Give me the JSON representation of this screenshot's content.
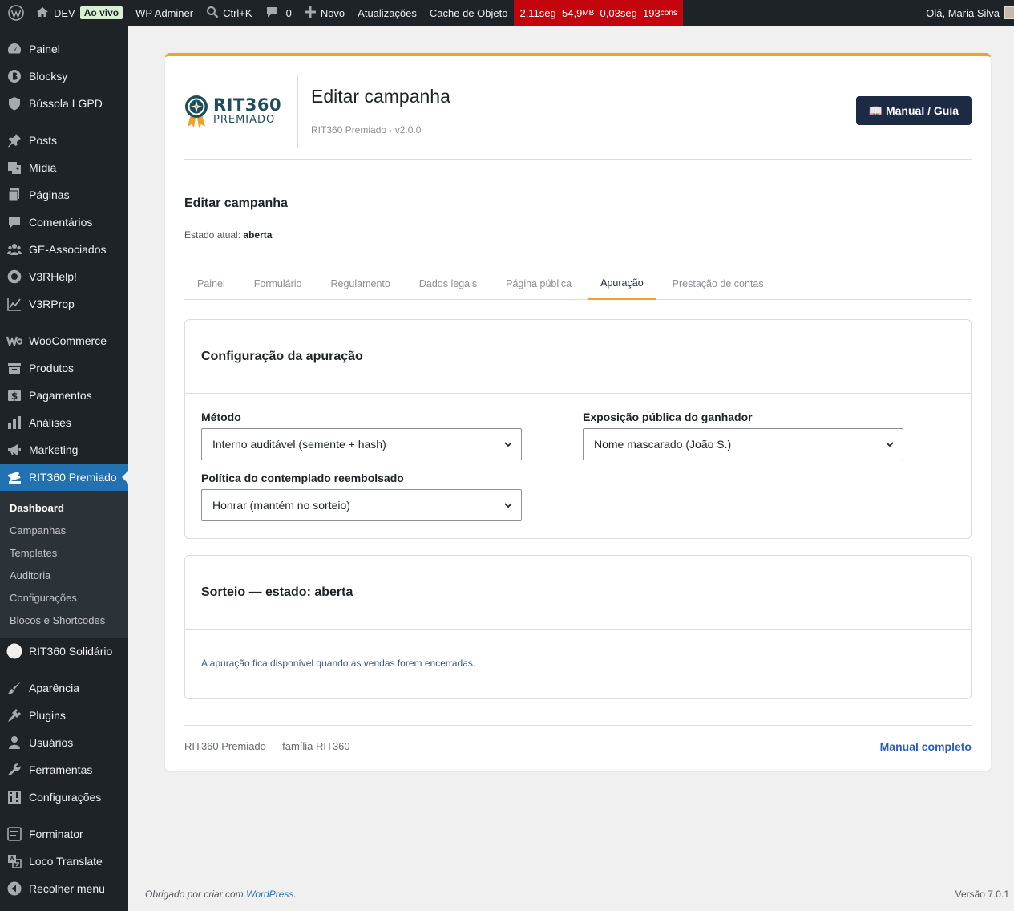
{
  "adminbar": {
    "site_name": "DEV",
    "live_badge": "Ao vivo",
    "adminer": "WP Adminer",
    "search_shortcut": "Ctrl+K",
    "comments_count": "0",
    "new_label": "Novo",
    "updates_label": "Atualizações",
    "cache_label": "Cache de Objeto",
    "qm_time": "2,11seg",
    "qm_mem": "54,9",
    "qm_mem_unit": "MB",
    "qm_db": "0,03seg",
    "qm_queries": "193",
    "qm_queries_unit": "cons",
    "greeting": "Olá, Maria Silva"
  },
  "sidebar": {
    "items": [
      {
        "label": "Painel",
        "icon": "dashboard-icon"
      },
      {
        "label": "Blocksy",
        "icon": "blocksy-icon"
      },
      {
        "label": "Bússola LGPD",
        "icon": "shield-icon"
      },
      {
        "label": "Posts",
        "icon": "pin-icon"
      },
      {
        "label": "Mídia",
        "icon": "media-icon"
      },
      {
        "label": "Páginas",
        "icon": "pages-icon"
      },
      {
        "label": "Comentários",
        "icon": "comment-icon"
      },
      {
        "label": "GE-Associados",
        "icon": "groups-icon"
      },
      {
        "label": "V3RHelp!",
        "icon": "help-ring-icon"
      },
      {
        "label": "V3RProp",
        "icon": "chart-line-icon"
      },
      {
        "label": "WooCommerce",
        "icon": "woo-icon"
      },
      {
        "label": "Produtos",
        "icon": "archive-icon"
      },
      {
        "label": "Pagamentos",
        "icon": "dollar-icon"
      },
      {
        "label": "Análises",
        "icon": "bar-chart-icon"
      },
      {
        "label": "Marketing",
        "icon": "megaphone-icon"
      },
      {
        "label": "RIT360 Premiado",
        "icon": "tickets-icon"
      },
      {
        "label": "RIT360 Solidário",
        "icon": "circle-icon"
      },
      {
        "label": "Aparência",
        "icon": "brush-icon"
      },
      {
        "label": "Plugins",
        "icon": "plug-icon"
      },
      {
        "label": "Usuários",
        "icon": "user-icon"
      },
      {
        "label": "Ferramentas",
        "icon": "wrench-icon"
      },
      {
        "label": "Configurações",
        "icon": "settings-icon"
      },
      {
        "label": "Forminator",
        "icon": "forminator-icon"
      },
      {
        "label": "Loco Translate",
        "icon": "translate-icon"
      },
      {
        "label": "Recolher menu",
        "icon": "collapse-icon"
      }
    ],
    "submenu": [
      "Dashboard",
      "Campanhas",
      "Templates",
      "Auditoria",
      "Configurações",
      "Blocos e Shortcodes"
    ]
  },
  "header": {
    "logo_main": "RIT360",
    "logo_sub": "PREMIADO",
    "title": "Editar campanha",
    "subtitle": "RIT360 Premiado · v2.0.0",
    "manual_button": "📖 Manual / Guia"
  },
  "main": {
    "section_title": "Editar campanha",
    "status_prefix": "Estado atual:",
    "status_value": "aberta",
    "tabs": [
      "Painel",
      "Formulário",
      "Regulamento",
      "Dados legais",
      "Página pública",
      "Apuração",
      "Prestação de contas"
    ],
    "active_tab": "Apuração"
  },
  "config_panel": {
    "title": "Configuração da apuração",
    "method_label": "Método",
    "method_value": "Interno auditável (semente + hash)",
    "exposure_label": "Exposição pública do ganhador",
    "exposure_value": "Nome mascarado (João S.)",
    "policy_label": "Política do contemplado reembolsado",
    "policy_value": "Honrar (mantém no sorteio)"
  },
  "draw_panel": {
    "title": "Sorteio — estado: aberta",
    "note": "A apuração fica disponível quando as vendas forem encerradas."
  },
  "card_footer": {
    "left": "RIT360 Premiado — família RIT360",
    "right": "Manual completo"
  },
  "wp_footer": {
    "thanks_prefix": "Obrigado por criar com",
    "wordpress": "WordPress",
    "thanks_suffix": ".",
    "version": "Versão 7.0.1"
  },
  "colors": {
    "accent": "#f0a12c",
    "admin_dark": "#1d2327",
    "active_menu": "#2271b1",
    "button_dark": "#1d2a44",
    "link": "#2c5cc5",
    "qm_red": "#c4050e"
  }
}
